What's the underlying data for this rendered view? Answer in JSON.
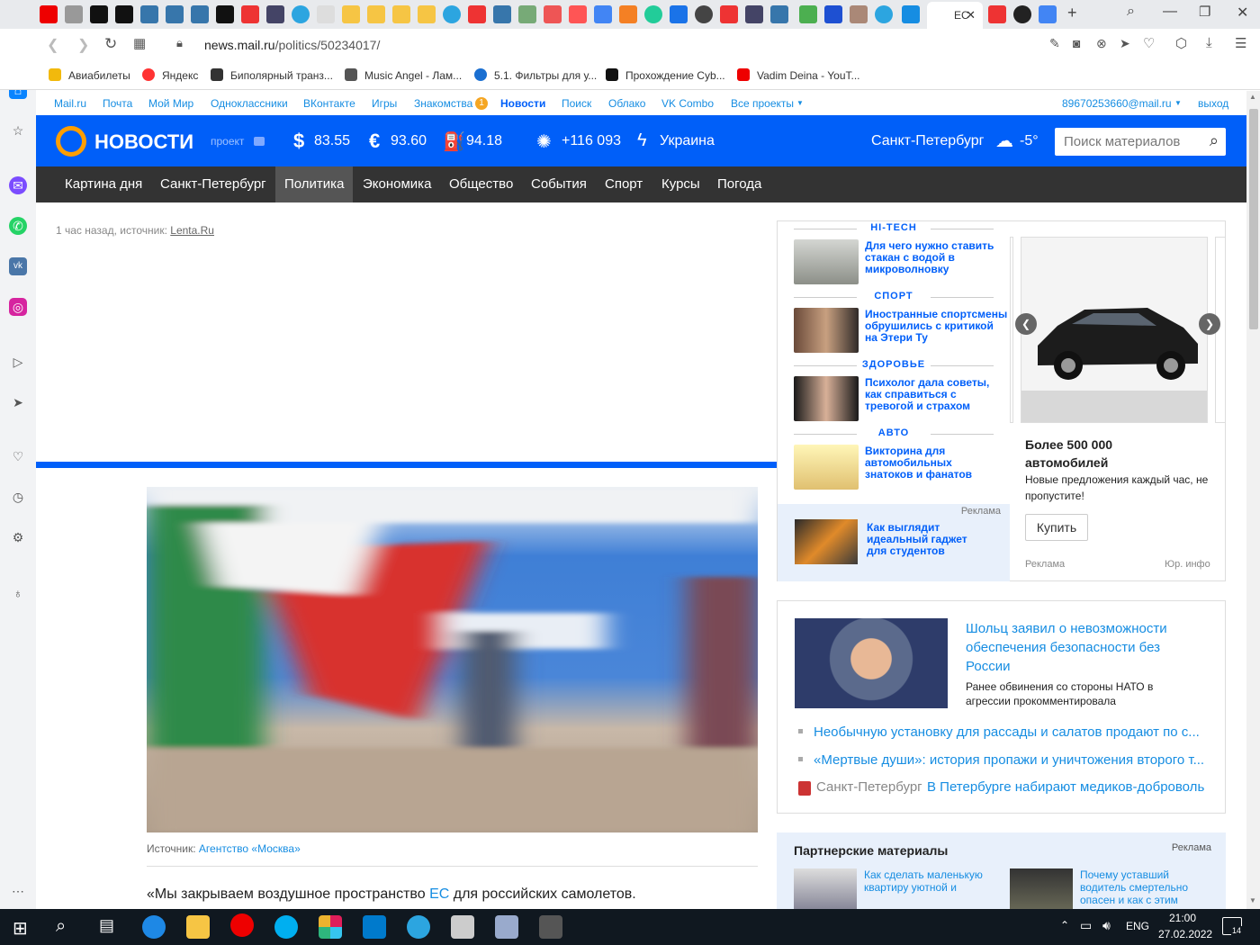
{
  "browser": {
    "active_tab_title": "ЕС",
    "url_host": "news.mail.ru",
    "url_path": "/politics/50234017/",
    "bookmarks": [
      "Авиабилеты",
      "Яндекс",
      "Биполярный транз...",
      "Music Angel - Лам...",
      "5.1. Фильтры для у...",
      "Прохождение Cyb...",
      "Vadim Deina - YouT..."
    ]
  },
  "portal": {
    "links": [
      "Mail.ru",
      "Почта",
      "Мой Мир",
      "Одноклассники",
      "ВКонтакте",
      "Игры",
      "Знакомства",
      "Новости",
      "Поиск",
      "Облако",
      "VK Combo",
      "Все проекты"
    ],
    "dating_badge": "1",
    "user_email": "89670253660@mail.ru",
    "logout": "выход"
  },
  "header": {
    "logo": "НОВОСТИ",
    "logo_sub": "проект",
    "usd": "83.55",
    "eur": "93.60",
    "oil": "94.18",
    "covid": "+116 093",
    "hot": "Украина",
    "city": "Санкт-Петербург",
    "temp": "-5°",
    "search_placeholder": "Поиск материалов"
  },
  "nav": [
    "Картина дня",
    "Санкт-Петербург",
    "Политика",
    "Экономика",
    "Общество",
    "События",
    "Спорт",
    "Курсы",
    "Погода"
  ],
  "article": {
    "meta_time": "1 час назад, источник: ",
    "meta_source": "Lenta.Ru",
    "caption_prefix": "Источник: ",
    "caption_source": "Агентство «Москва»",
    "lead_a": "«Мы закрываем воздушное пространство ",
    "lead_link": "ЕС",
    "lead_b": " для российских самолетов."
  },
  "teasers": [
    {
      "cat": "HI-TECH",
      "title": "Для чего нужно ставить стакан с водой в микроволновку"
    },
    {
      "cat": "СПОРТ",
      "title": "Иностранные спортсмены обрушились с критикой на Этери Ту"
    },
    {
      "cat": "ЗДОРОВЬЕ",
      "title": "Психолог дала советы, как справиться с тревогой и страхом"
    },
    {
      "cat": "АВТО",
      "title": "Викторина для автомобильных знатоков и фанатов"
    }
  ],
  "promo": {
    "label": "Реклама",
    "title": "Как выглядит идеальный гаджет для студентов"
  },
  "car_ad": {
    "headline": "Более 500 000 автомобилей",
    "text": "Новые предложения каждый час, не пропустите!",
    "button": "Купить",
    "ad_label": "Реклама",
    "legal": "Юр. инфо"
  },
  "related": {
    "main_title": "Шольц заявил о невозможности обеспечения безопасности без России",
    "main_desc": "Ранее обвинения со стороны НАТО в агрессии прокомментировала",
    "items": [
      "Необычную установку для рассады и салатов продают по с...",
      "«Мертвые души»: история пропажи и уничтожения второго т..."
    ],
    "city_label": "Санкт-Петербург",
    "city_item": "В Петербурге набирают медиков-доброволь"
  },
  "partners": {
    "title": "Партнерские материалы",
    "label": "Реклама",
    "items": [
      "Как сделать маленькую квартиру уютной и",
      "Почему уставший водитель смертельно опасен и как с этим"
    ]
  },
  "taskbar": {
    "lang": "ENG",
    "time": "21:00",
    "date": "27.02.2022",
    "notif": "14"
  }
}
